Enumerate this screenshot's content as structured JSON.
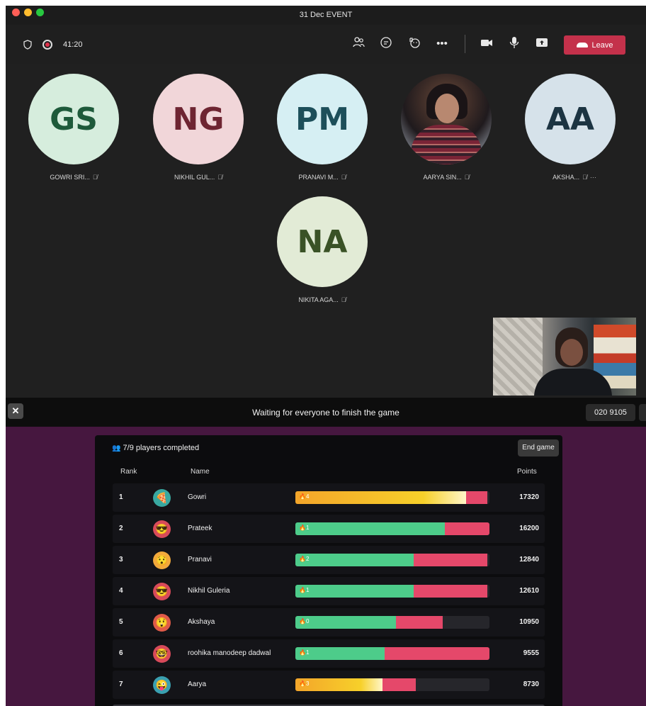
{
  "window": {
    "title": "31 Dec EVENT"
  },
  "meeting": {
    "timer": "41:20",
    "leave_label": "Leave",
    "colors": {
      "leave": "#c4314b"
    }
  },
  "participants": [
    {
      "initials": "GS",
      "name": "GOWRI SRI...",
      "bg": "#d6eddd",
      "fg": "#1e5a3a"
    },
    {
      "initials": "NG",
      "name": "NIKHIL GUL...",
      "bg": "#f1d6d9",
      "fg": "#6e2532"
    },
    {
      "initials": "PM",
      "name": "PRANAVI M...",
      "bg": "#d6eff3",
      "fg": "#1d4f5a"
    },
    {
      "initials": "",
      "name": "AARYA SIN...",
      "bg": "#5a4a4a",
      "fg": "#ffffff"
    },
    {
      "initials": "AA",
      "name": "AKSHA...",
      "bg": "#d6e2ea",
      "fg": "#1c3442"
    },
    {
      "initials": "NA",
      "name": "NIKITA AGA...",
      "bg": "#e2ebd6",
      "fg": "#3a5226"
    }
  ],
  "game": {
    "status": "Waiting for everyone to finish the game",
    "code": "020 9105",
    "completed": "7/9 players completed",
    "end_label": "End game",
    "headers": {
      "rank": "Rank",
      "name": "Name",
      "points": "Points"
    },
    "colors": {
      "correct": "#4dcc8a",
      "incorrect": "#e5486a",
      "streak": "#f3a52a"
    },
    "rows": [
      {
        "rank": "1",
        "name": "Gowri",
        "streak": "4",
        "correct": 0.88,
        "incorrect": 0.11,
        "points": "17320",
        "emoji": "🍕",
        "emoji_bg": "#39a8a0",
        "gold": true
      },
      {
        "rank": "2",
        "name": "Prateek",
        "streak": "1",
        "correct": 0.77,
        "incorrect": 0.23,
        "points": "16200",
        "emoji": "😎",
        "emoji_bg": "#d84a5a",
        "gold": false
      },
      {
        "rank": "3",
        "name": "Pranavi",
        "streak": "2",
        "correct": 0.61,
        "incorrect": 0.38,
        "points": "12840",
        "emoji": "😯",
        "emoji_bg": "#f2a93b",
        "gold": false
      },
      {
        "rank": "4",
        "name": "Nikhil Guleria",
        "streak": "1",
        "correct": 0.61,
        "incorrect": 0.38,
        "points": "12610",
        "emoji": "😎",
        "emoji_bg": "#d84a5a",
        "gold": false
      },
      {
        "rank": "5",
        "name": "Akshaya",
        "streak": "0",
        "correct": 0.52,
        "incorrect": 0.24,
        "points": "10950",
        "emoji": "😲",
        "emoji_bg": "#e05a48",
        "gold": false
      },
      {
        "rank": "6",
        "name": "roohika manodeep dadwal",
        "streak": "1",
        "correct": 0.46,
        "incorrect": 0.54,
        "points": "9555",
        "emoji": "🤓",
        "emoji_bg": "#d84a5a",
        "gold": false
      },
      {
        "rank": "7",
        "name": "Aarya",
        "streak": "3",
        "correct": 0.45,
        "incorrect": 0.17,
        "points": "8730",
        "emoji": "😜",
        "emoji_bg": "#3aa0b0",
        "gold": true
      }
    ]
  }
}
